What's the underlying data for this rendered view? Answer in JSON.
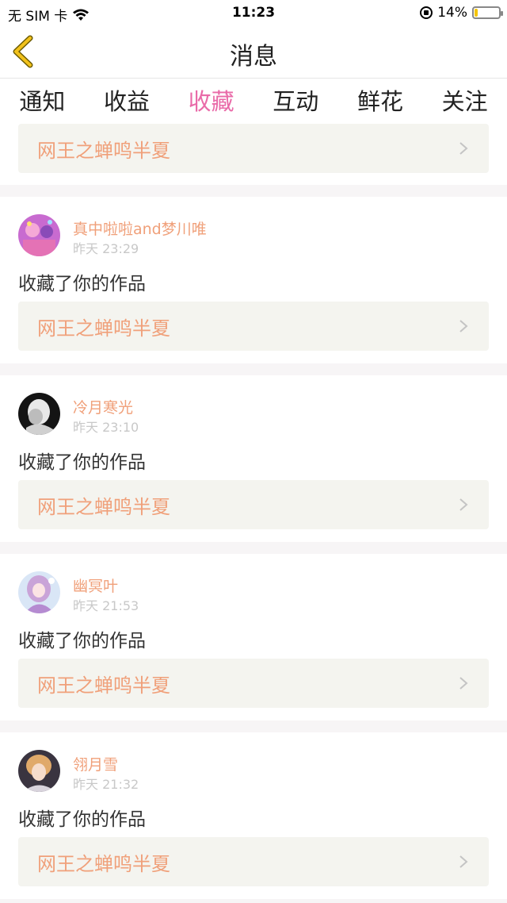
{
  "status_bar": {
    "carrier": "无 SIM 卡",
    "time": "11:23",
    "battery": "14%",
    "battery_level": 0.14
  },
  "nav": {
    "title": "消息",
    "back_icon": "chevron-left-icon"
  },
  "tabs": [
    {
      "label": "通知"
    },
    {
      "label": "收益"
    },
    {
      "label": "收藏",
      "active": true
    },
    {
      "label": "互动"
    },
    {
      "label": "鲜花"
    },
    {
      "label": "关注"
    }
  ],
  "first_card": {
    "work_title": "网王之蝉鸣半夏"
  },
  "entries": [
    {
      "username": "真中啦啦and梦川唯",
      "time": "昨天 23:29",
      "action": "收藏了你的作品",
      "work_title": "网王之蝉鸣半夏"
    },
    {
      "username": "冷月寒光",
      "time": "昨天 23:10",
      "action": "收藏了你的作品",
      "work_title": "网王之蝉鸣半夏"
    },
    {
      "username": "幽冥叶",
      "time": "昨天 21:53",
      "action": "收藏了你的作品",
      "work_title": "网王之蝉鸣半夏"
    },
    {
      "username": "翎月雪",
      "time": "昨天 21:32",
      "action": "收藏了你的作品",
      "work_title": "网王之蝉鸣半夏"
    }
  ],
  "colors": {
    "accent": "#e96aa8",
    "username": "#f0a07a",
    "back_arrow": "#f2c21b"
  }
}
